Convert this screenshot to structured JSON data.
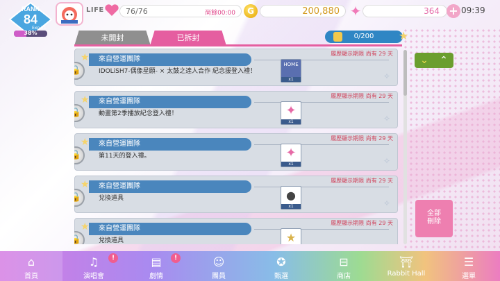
{
  "colors": {
    "accent_pink": "#e55ea0",
    "item_header_blue": "#4a86bd",
    "sort_green": "#6b9e2e",
    "delete_pink": "#ee7fb0"
  },
  "status": {
    "rank_label": "RANK",
    "rank_value": "84",
    "exp_label": "Exp.31",
    "exp_percent": "38%",
    "exp_fraction": 0.38,
    "life_label": "LIFE",
    "life_value": "76/76",
    "life_remaining": "尚餘00:00",
    "coin_symbol": "G",
    "gold": "200,880",
    "gems": "364",
    "time": "09:39"
  },
  "tabs": {
    "sealed": "未開封",
    "opened": "已拆封"
  },
  "present_count": "0/200",
  "items": [
    {
      "header": "來自營運團隊",
      "limit": "履歷顯示期限 尚有 29 天",
      "body": "IDOLiSH7-偶像星願- × 太鼓之達人合作 紀念援登入禮！",
      "thumb": "HOME",
      "qty": "x1"
    },
    {
      "header": "來自營運團隊",
      "limit": "履歷顯示期限 尚有 29 天",
      "body": "動畫第2季播放紀念登入禮！",
      "thumb": "",
      "qty": "x1"
    },
    {
      "header": "來自營運團隊",
      "limit": "履歷顯示期限 尚有 29 天",
      "body": "第11天的登入禮。",
      "thumb": "",
      "qty": "x1"
    },
    {
      "header": "來自營運團隊",
      "limit": "履歷顯示期限 尚有 29 天",
      "body": "兌換道具",
      "thumb": "",
      "qty": "x1"
    },
    {
      "header": "來自營運團隊",
      "limit": "履歷顯示期限 尚有 29 天",
      "body": "兌換道具",
      "thumb": "",
      "qty": ""
    }
  ],
  "icons": {
    "sort_down": "chevron-down-icon",
    "sort_up": "chevron-up-icon"
  },
  "delete_all": {
    "line1": "全部",
    "line2": "刪除"
  },
  "nav": [
    {
      "label": "首頁",
      "icon": "home-icon",
      "badge": ""
    },
    {
      "label": "演唱會",
      "icon": "music-note-icon",
      "badge": "!"
    },
    {
      "label": "劇情",
      "icon": "book-icon",
      "badge": "!"
    },
    {
      "label": "團員",
      "icon": "member-icon",
      "badge": ""
    },
    {
      "label": "甄選",
      "icon": "card-icon",
      "badge": ""
    },
    {
      "label": "商店",
      "icon": "basket-icon",
      "badge": ""
    },
    {
      "label": "Rabbit Hall",
      "icon": "hall-icon",
      "badge": ""
    },
    {
      "label": "選單",
      "icon": "menu-icon",
      "badge": ""
    }
  ]
}
